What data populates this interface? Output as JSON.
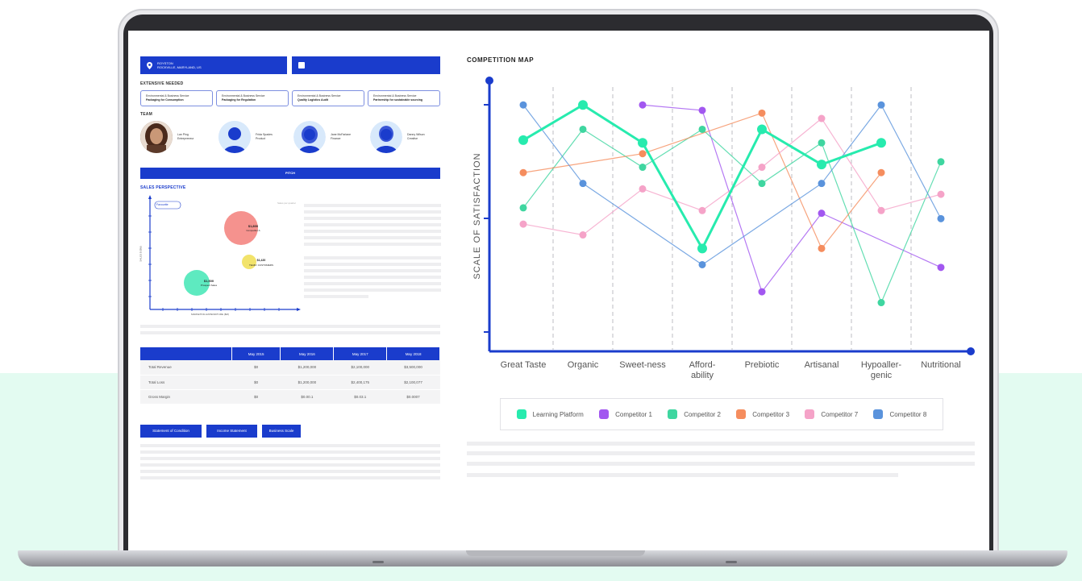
{
  "location": {
    "line1": "ROYSTON",
    "line2": "ROCKVILLE, MARYLAND, US"
  },
  "sections": {
    "features": "EXTENSIVE NEEDED",
    "team": "TEAM",
    "sales": "SALES PERSPECTIVE"
  },
  "features": [
    {
      "line1": "Environmental & Business Service",
      "line2": "Packaging for Consumption"
    },
    {
      "line1": "Environmental & Business Service",
      "line2": "Packaging for Regulation"
    },
    {
      "line1": "Environmental & Business Service",
      "line2": "Quality Logistics Audit"
    },
    {
      "line1": "Environmental & Business Service",
      "line2": "Partnership for sustainable sourcing"
    }
  ],
  "team": [
    {
      "name": "Lan Ping",
      "role": "Entrepreneur"
    },
    {
      "name": "Frida Spades",
      "role": "Product"
    },
    {
      "name": "Jane McFarlane",
      "role": "Finance"
    },
    {
      "name": "Danny Wilson",
      "role": "Creative"
    }
  ],
  "pitch_label": "PITCH",
  "sales_chart": {
    "tag": "Favourite",
    "top_note": "Sales per quarter",
    "bubbles": [
      {
        "value": "$1,800",
        "label": "Competitor A",
        "color": "#f5928e"
      },
      {
        "value": "$1,420",
        "label": "TEAM / CUSTOMERS",
        "color": "#f2e36b"
      },
      {
        "value": "$1,500",
        "label": "Prospect Sales",
        "color": "#5eeac0"
      }
    ],
    "ylabel": "SALES $ ($M)",
    "xlabel": "MARKETING EXPENDITURE ($M)"
  },
  "revenue_table": {
    "headers": [
      "",
      "May 2015",
      "May 2016",
      "May 2017",
      "May 2018"
    ],
    "rows": [
      [
        "Total Revenue",
        "$0",
        "$1,200,000",
        "$2,100,000",
        "$3,500,000"
      ],
      [
        "Total Loss",
        "$0",
        "$1,200,000",
        "$2,400,175",
        "$2,100,077"
      ],
      [
        "Gross Margin",
        "$0",
        "$0.00.1",
        "$0.03.1",
        "$0.0007"
      ]
    ]
  },
  "buttons": [
    "Statement of Condition",
    "Income Statement",
    "Business Scale"
  ],
  "competition_map": {
    "title": "COMPETITION MAP"
  },
  "chart_data": {
    "type": "line",
    "ylabel": "SCALE OF SATISFACTION",
    "categories": [
      "Great Taste",
      "Organic",
      "Sweet-ness",
      "Afford-ability",
      "Prebiotic",
      "Artisanal",
      "Hypoaller-genic",
      "Nutritional"
    ],
    "ylim": [
      0,
      100
    ],
    "series": [
      {
        "name": "Learning Platform",
        "color": "#27ebae",
        "values": [
          78,
          91,
          77,
          38,
          82,
          69,
          77,
          null
        ]
      },
      {
        "name": "Competitor 1",
        "color": "#a257f0",
        "values": [
          null,
          null,
          91,
          89,
          22,
          51,
          null,
          31
        ]
      },
      {
        "name": "Competitor 2",
        "color": "#3fd6a0",
        "values": [
          53,
          82,
          68,
          82,
          62,
          77,
          18,
          70
        ]
      },
      {
        "name": "Competitor 3",
        "color": "#f58d5e",
        "values": [
          66,
          null,
          73,
          null,
          88,
          38,
          66,
          null
        ]
      },
      {
        "name": "Competitor 7",
        "color": "#f5a3c8",
        "values": [
          47,
          43,
          60,
          52,
          68,
          86,
          52,
          58
        ]
      },
      {
        "name": "Competitor 8",
        "color": "#5a93dc",
        "values": [
          91,
          62,
          null,
          32,
          null,
          62,
          91,
          49
        ]
      }
    ]
  }
}
